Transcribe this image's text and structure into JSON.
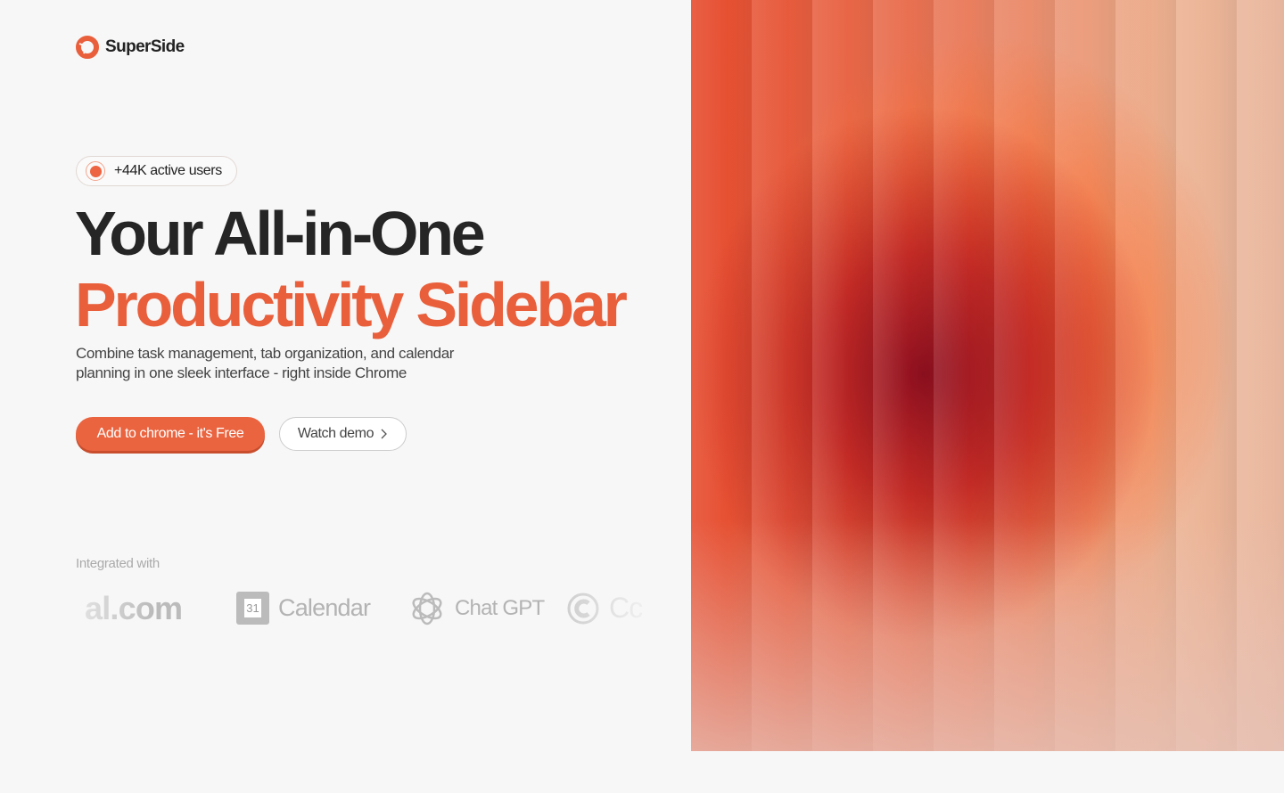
{
  "brand": {
    "name": "SuperSide",
    "color": "#e95f3c"
  },
  "hero": {
    "badge": "+44K active users",
    "title_line1": "Your All-in-One",
    "title_line2": "Productivity Sidebar",
    "subtitle": "Combine task management, tab organization, and calendar planning in one sleek interface - right inside Chrome",
    "primary_button": "Add to chrome - it's Free",
    "secondary_button": "Watch demo"
  },
  "integrations": {
    "label": "Integrated with",
    "items": [
      {
        "name": "al.com",
        "icon": "cal-com-logo"
      },
      {
        "name": "Calendar",
        "icon": "google-calendar-icon",
        "icon_text": "31"
      },
      {
        "name": "Chat GPT",
        "icon": "openai-icon"
      },
      {
        "name": "Cc",
        "icon": "copyright-c-icon"
      }
    ]
  }
}
